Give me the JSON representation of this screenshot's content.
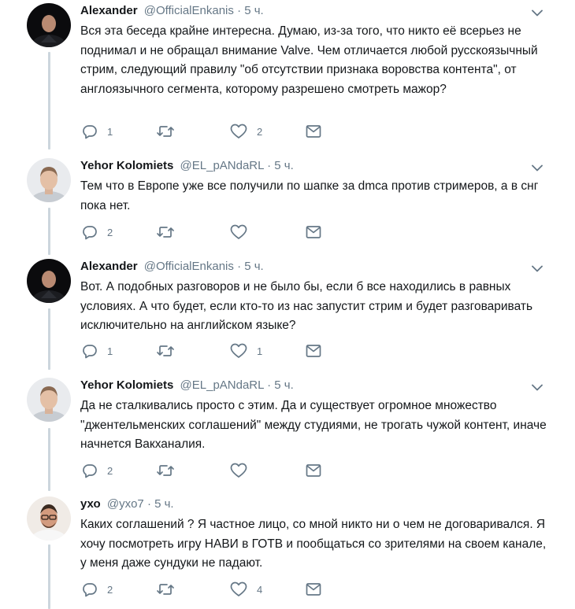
{
  "tweets": [
    {
      "name": "Alexander",
      "handle": "@OfficialEnkanis",
      "separator": "·",
      "time": "5 ч.",
      "text": "Вся эта беседа крайне интересна. Думаю, из-за того, что никто её всерьез не поднимал и не обращал внимание Valve. Чем отличается любой русскоязычный стрим, следующий правилу \"об отсутствии признака воровства контента\", от англоязычного сегмента, которому разрешено смотреть мажор?",
      "replies": "1",
      "retweets": "",
      "likes": "2"
    },
    {
      "name": "Yehor Kolomiets",
      "handle": "@EL_pANdaRL",
      "separator": "·",
      "time": "5 ч.",
      "text": "Тем что в Европе уже все получили по шапке за dmca против стримеров, а в снг пока нет.",
      "replies": "2",
      "retweets": "",
      "likes": ""
    },
    {
      "name": "Alexander",
      "handle": "@OfficialEnkanis",
      "separator": "·",
      "time": "5 ч.",
      "text": "Вот. А подобных разговоров и не было бы, если б все находились в равных условиях. А что будет, если кто-то из нас запустит стрим и будет разговаривать исключительно на английском языке?",
      "replies": "1",
      "retweets": "",
      "likes": "1"
    },
    {
      "name": "Yehor Kolomiets",
      "handle": "@EL_pANdaRL",
      "separator": "·",
      "time": "5 ч.",
      "text": "Да не сталкивались просто с этим. Да и существует огромное множество \"джентельменских соглашений\" между студиями, не трогать чужой контент, иначе начнется Вакханалия.",
      "replies": "2",
      "retweets": "",
      "likes": ""
    },
    {
      "name": "ухо",
      "handle": "@yxo7",
      "separator": "·",
      "time": "5 ч.",
      "text": "Каких соглашений ? Я частное лицо, со мной никто ни о чем не договаривался. Я хочу посмотреть игру НАВИ в ГОТВ и пообщаться со зрителями на своем канале, у меня даже сундуки не падают.",
      "replies": "2",
      "retweets": "",
      "likes": "4"
    }
  ]
}
